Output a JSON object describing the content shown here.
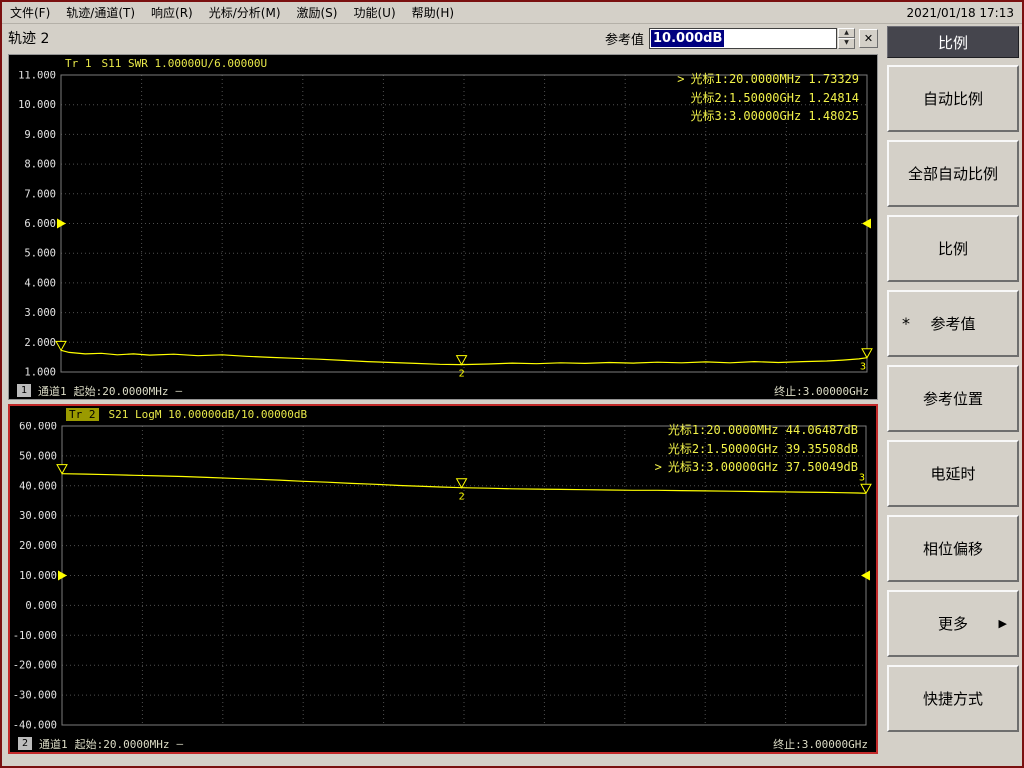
{
  "menu": {
    "items": [
      "文件(F)",
      "轨迹/通道(T)",
      "响应(R)",
      "光标/分析(M)",
      "激励(S)",
      "功能(U)",
      "帮助(H)"
    ],
    "datetime": "2021/01/18 17:13"
  },
  "toolbar": {
    "trace_label": "轨迹 2",
    "ref_label": "参考值",
    "ref_value": "10.000dB",
    "spin_up": "▲",
    "spin_down": "▼",
    "close_label": "✕"
  },
  "sidebar": {
    "header": "比例",
    "buttons": [
      {
        "name": "auto-scale",
        "label": "自动比例"
      },
      {
        "name": "auto-scale-all",
        "label": "全部自动比例"
      },
      {
        "name": "scale",
        "label": "比例"
      },
      {
        "name": "reference-value",
        "label": "参考值",
        "prefix": "*"
      },
      {
        "name": "reference-position",
        "label": "参考位置"
      },
      {
        "name": "electrical-delay",
        "label": "电延时"
      },
      {
        "name": "phase-offset",
        "label": "相位偏移"
      },
      {
        "name": "more",
        "label": "更多",
        "suffix": "▶"
      },
      {
        "name": "shortcut",
        "label": "快捷方式"
      }
    ]
  },
  "colors": {
    "trace": "#ffff00",
    "grid": "#4f4f4f",
    "chart_bg": "#000000",
    "active_border": "#c22a2a",
    "selection": "#000080"
  },
  "chart_data": [
    {
      "type": "line",
      "trace_id": "Tr 1",
      "trace_active": false,
      "title": "S11 SWR 1.00000U/6.00000U",
      "y_ticks": [
        "11.000",
        "10.000",
        "9.000",
        "8.000",
        "7.000",
        "6.000",
        "5.000",
        "4.000",
        "3.000",
        "2.000",
        "1.000"
      ],
      "y_min": 1,
      "y_max": 11,
      "x_divisions": 10,
      "ref_level": 6,
      "x_start": "20.0000MHz",
      "x_stop": "3.00000GHz",
      "markers_readout": [
        {
          "active": true,
          "text": "光标1:20.0000MHz 1.73329"
        },
        {
          "active": false,
          "text": "光标2:1.50000GHz 1.24814"
        },
        {
          "active": false,
          "text": "光标3:3.00000GHz 1.48025"
        }
      ],
      "trace_points": [
        [
          0,
          1.73
        ],
        [
          0.01,
          1.66
        ],
        [
          0.03,
          1.61
        ],
        [
          0.05,
          1.63
        ],
        [
          0.07,
          1.58
        ],
        [
          0.09,
          1.61
        ],
        [
          0.11,
          1.57
        ],
        [
          0.14,
          1.6
        ],
        [
          0.17,
          1.55
        ],
        [
          0.2,
          1.58
        ],
        [
          0.23,
          1.53
        ],
        [
          0.26,
          1.49
        ],
        [
          0.29,
          1.46
        ],
        [
          0.32,
          1.43
        ],
        [
          0.35,
          1.39
        ],
        [
          0.38,
          1.35
        ],
        [
          0.41,
          1.32
        ],
        [
          0.44,
          1.29
        ],
        [
          0.47,
          1.26
        ],
        [
          0.497,
          1.25
        ],
        [
          0.53,
          1.27
        ],
        [
          0.56,
          1.3
        ],
        [
          0.59,
          1.28
        ],
        [
          0.62,
          1.31
        ],
        [
          0.65,
          1.29
        ],
        [
          0.68,
          1.32
        ],
        [
          0.71,
          1.3
        ],
        [
          0.74,
          1.33
        ],
        [
          0.77,
          1.31
        ],
        [
          0.8,
          1.34
        ],
        [
          0.83,
          1.31
        ],
        [
          0.86,
          1.35
        ],
        [
          0.89,
          1.32
        ],
        [
          0.92,
          1.35
        ],
        [
          0.95,
          1.37
        ],
        [
          0.97,
          1.4
        ],
        [
          0.99,
          1.44
        ],
        [
          1.0,
          1.48
        ]
      ],
      "trace_markers": [
        {
          "n": "1",
          "x": 0.0,
          "y": 1.73,
          "label": "none"
        },
        {
          "n": "2",
          "x": 0.497,
          "y": 1.248,
          "label": "below"
        },
        {
          "n": "3",
          "x": 1.0,
          "y": 1.48,
          "label": "below"
        }
      ],
      "footer": {
        "badge": "1",
        "channel": "通道1",
        "start": "起始:20.0000MHz",
        "dash": "—",
        "stop": "终止:3.00000GHz"
      }
    },
    {
      "type": "line",
      "trace_id": "Tr 2",
      "trace_active": true,
      "title": "S21 LogM 10.00000dB/10.00000dB",
      "y_ticks": [
        "60.000",
        "50.000",
        "40.000",
        "30.000",
        "20.000",
        "10.000",
        "0.000",
        "-10.000",
        "-20.000",
        "-30.000",
        "-40.000"
      ],
      "y_min": -40,
      "y_max": 60,
      "x_divisions": 10,
      "ref_level": 10,
      "x_start": "20.0000MHz",
      "x_stop": "3.00000GHz",
      "markers_readout": [
        {
          "active": false,
          "text": "光标1:20.0000MHz 44.06487dB"
        },
        {
          "active": false,
          "text": "光标2:1.50000GHz 39.35508dB"
        },
        {
          "active": true,
          "text": "光标3:3.00000GHz 37.50049dB"
        }
      ],
      "trace_points": [
        [
          0,
          44.06
        ],
        [
          0.03,
          43.9
        ],
        [
          0.06,
          43.7
        ],
        [
          0.09,
          43.5
        ],
        [
          0.12,
          43.3
        ],
        [
          0.15,
          43.1
        ],
        [
          0.18,
          42.8
        ],
        [
          0.21,
          42.5
        ],
        [
          0.24,
          42.2
        ],
        [
          0.27,
          41.9
        ],
        [
          0.3,
          41.5
        ],
        [
          0.33,
          41.2
        ],
        [
          0.36,
          40.8
        ],
        [
          0.39,
          40.5
        ],
        [
          0.42,
          40.1
        ],
        [
          0.45,
          39.8
        ],
        [
          0.47,
          39.6
        ],
        [
          0.497,
          39.36
        ],
        [
          0.53,
          39.2
        ],
        [
          0.56,
          39.0
        ],
        [
          0.59,
          38.9
        ],
        [
          0.62,
          38.8
        ],
        [
          0.65,
          38.7
        ],
        [
          0.68,
          38.6
        ],
        [
          0.71,
          38.5
        ],
        [
          0.74,
          38.5
        ],
        [
          0.77,
          38.4
        ],
        [
          0.8,
          38.3
        ],
        [
          0.83,
          38.2
        ],
        [
          0.86,
          38.1
        ],
        [
          0.89,
          38.0
        ],
        [
          0.92,
          37.9
        ],
        [
          0.95,
          37.8
        ],
        [
          0.97,
          37.7
        ],
        [
          0.99,
          37.6
        ],
        [
          1.0,
          37.5
        ]
      ],
      "trace_markers": [
        {
          "n": "1",
          "x": 0.0,
          "y": 44.06,
          "label": "none"
        },
        {
          "n": "2",
          "x": 0.497,
          "y": 39.36,
          "label": "below"
        },
        {
          "n": "3",
          "x": 1.0,
          "y": 37.5,
          "label": "above"
        }
      ],
      "footer": {
        "badge": "2",
        "channel": "通道1",
        "start": "起始:20.0000MHz",
        "dash": "—",
        "stop": "终止:3.00000GHz"
      }
    }
  ]
}
